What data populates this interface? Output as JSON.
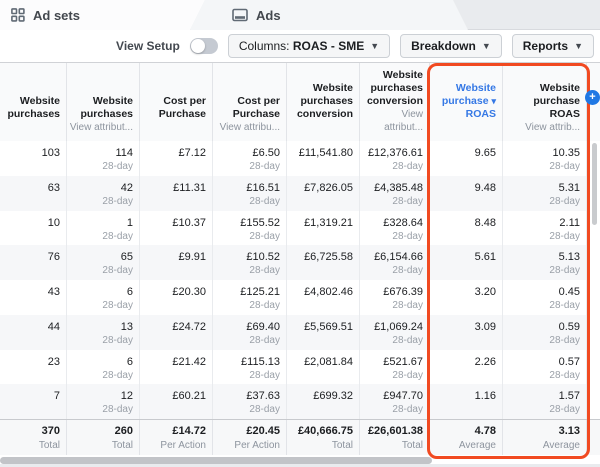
{
  "tabs": {
    "ad_sets": "Ad sets",
    "ads": "Ads"
  },
  "toolbar": {
    "view_setup": "View Setup",
    "columns_prefix": "Columns:",
    "columns_value": "ROAS - SME",
    "breakdown": "Breakdown",
    "reports": "Reports"
  },
  "table": {
    "columns": [
      {
        "title": "Website purchases",
        "sub": "",
        "sorted": false
      },
      {
        "title": "Website purchases",
        "sub": "View attribut...",
        "sorted": false
      },
      {
        "title": "Cost per Purchase",
        "sub": "",
        "sorted": false
      },
      {
        "title": "Cost per Purchase",
        "sub": "View attribu...",
        "sorted": false
      },
      {
        "title": "Website purchases conversion",
        "sub": "",
        "sorted": false
      },
      {
        "title": "Website purchases conversion",
        "sub": "View attribut...",
        "sorted": false
      },
      {
        "title": "Website purchase ROAS",
        "sub": "",
        "sorted": true,
        "sort_caret_after_word": 2
      },
      {
        "title": "Website purchase ROAS",
        "sub": "View attrib...",
        "sorted": false
      }
    ],
    "attribution_window": "28-day",
    "attribution_cols": [
      1,
      3,
      5,
      7
    ],
    "rows": [
      [
        "103",
        "114",
        "£7.12",
        "£6.50",
        "£11,541.80",
        "£12,376.61",
        "9.65",
        "10.35"
      ],
      [
        "63",
        "42",
        "£11.31",
        "£16.51",
        "£7,826.05",
        "£4,385.48",
        "9.48",
        "5.31"
      ],
      [
        "10",
        "1",
        "£10.37",
        "£155.52",
        "£1,319.21",
        "£328.64",
        "8.48",
        "2.11"
      ],
      [
        "76",
        "65",
        "£9.91",
        "£10.52",
        "£6,725.58",
        "£6,154.66",
        "5.61",
        "5.13"
      ],
      [
        "43",
        "6",
        "£20.30",
        "£125.21",
        "£4,802.46",
        "£676.39",
        "3.20",
        "0.45"
      ],
      [
        "44",
        "13",
        "£24.72",
        "£69.40",
        "£5,569.51",
        "£1,069.24",
        "3.09",
        "0.59"
      ],
      [
        "23",
        "6",
        "£21.42",
        "£115.13",
        "£2,081.84",
        "£521.67",
        "2.26",
        "0.57"
      ],
      [
        "7",
        "12",
        "£60.21",
        "£37.63",
        "£699.32",
        "£947.70",
        "1.16",
        "1.57"
      ]
    ],
    "footer": {
      "values": [
        "370",
        "260",
        "£14.72",
        "£20.45",
        "£40,666.75",
        "£26,601.38",
        "4.78",
        "3.13"
      ],
      "labels": [
        "Total",
        "Total",
        "Per Action",
        "Per Action",
        "Total",
        "Total",
        "Average",
        "Average"
      ]
    }
  },
  "add_column_label": "+",
  "icons": {
    "ad_sets_tab": "grid-icon",
    "ads_tab": "ads-card-icon",
    "dropdown": "chevron-down-icon",
    "sort": "sort-descending-icon",
    "add_column": "plus-icon"
  },
  "colors": {
    "highlight_border": "#f14a21",
    "sorted_header_text": "#3578e5",
    "add_button_blue": "#2078e4"
  }
}
